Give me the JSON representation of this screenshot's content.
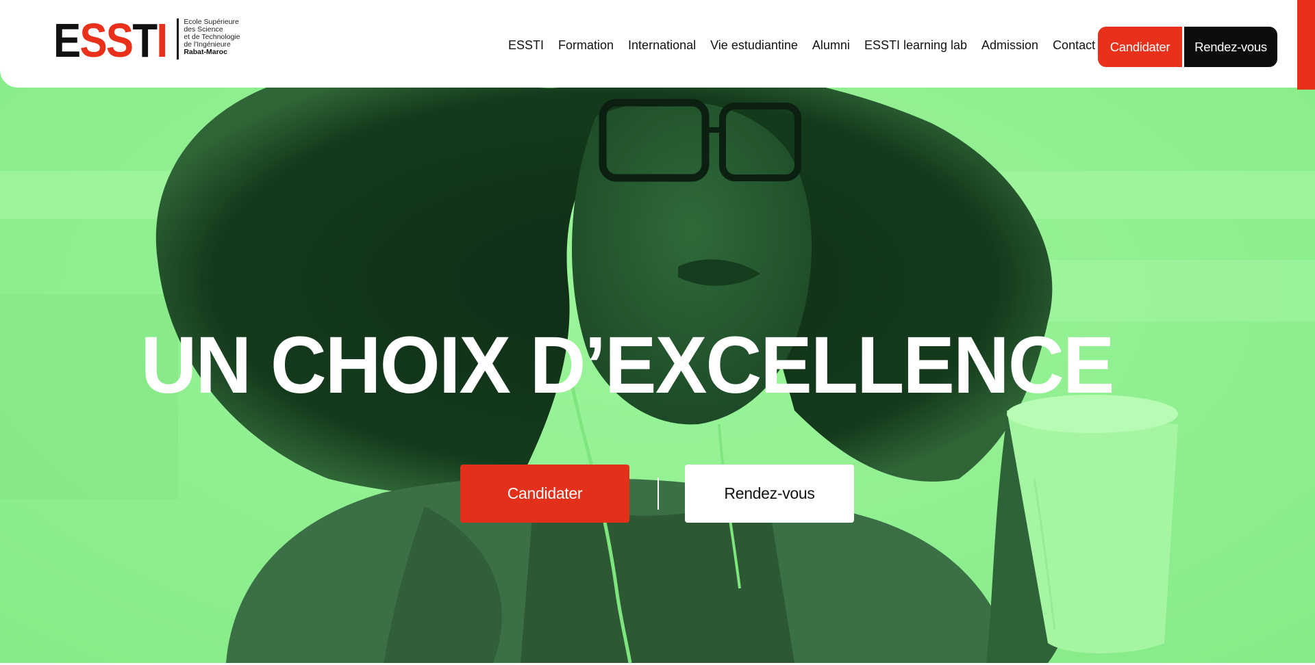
{
  "header": {
    "logo": {
      "letters": [
        "E",
        "S",
        "S",
        "T",
        "I"
      ],
      "tagline_lines": [
        "Ecole Supérieure",
        "des Science",
        "et de Technologie",
        "de l'Ingénieure"
      ],
      "location": "Rabat-Maroc"
    },
    "nav": [
      {
        "label": "ESSTI"
      },
      {
        "label": "Formation"
      },
      {
        "label": "International"
      },
      {
        "label": "Vie estudiantine"
      },
      {
        "label": "Alumni"
      },
      {
        "label": "ESSTI learning lab"
      },
      {
        "label": "Admission"
      },
      {
        "label": "Contact"
      }
    ],
    "cta": {
      "apply_label": "Candidater",
      "appointment_label": "Rendez-vous"
    }
  },
  "hero": {
    "title": "UN CHOIX D’EXCELLENCE",
    "apply_label": "Candidater",
    "appointment_label": "Rendez-vous",
    "image": "student-with-glasses-and-earphones-photo"
  },
  "colors": {
    "accent_red": "#e8301a",
    "hero_green": "#8ef28f",
    "dark": "#0d0d0d",
    "white": "#ffffff"
  }
}
